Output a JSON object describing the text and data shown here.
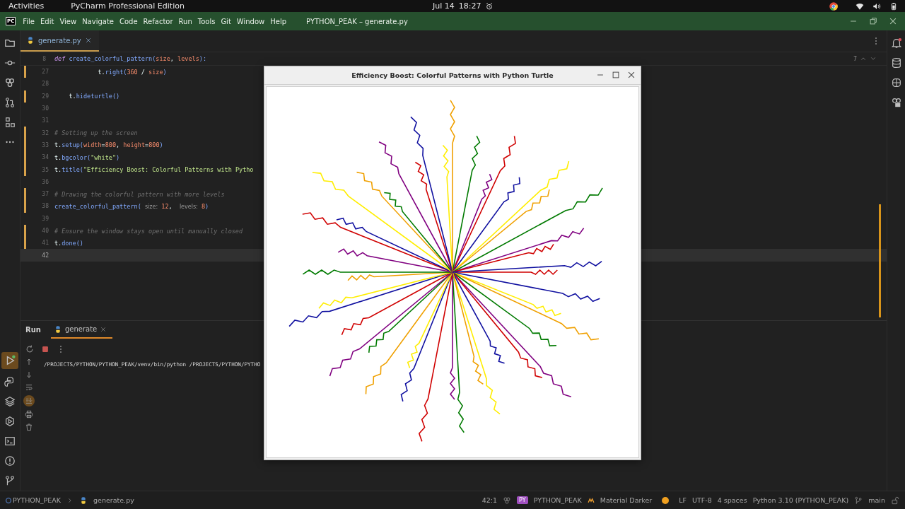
{
  "system_bar": {
    "activities": "Activities",
    "app_name": "PyCharm Professional Edition",
    "date": "Jul 14",
    "time": "18:27"
  },
  "title_bar": {
    "logo": "PC",
    "menu": [
      "File",
      "Edit",
      "View",
      "Navigate",
      "Code",
      "Refactor",
      "Run",
      "Tools",
      "Git",
      "Window",
      "Help"
    ],
    "project_title": "PYTHON_PEAK – generate.py"
  },
  "editor_tabs": [
    {
      "label": "generate.py",
      "selected": true
    }
  ],
  "inspection": {
    "count": "7"
  },
  "sticky_line": {
    "number": "8",
    "segments": [
      {
        "kind": "kw",
        "text": "def "
      },
      {
        "kind": "fn",
        "text": "create_colorful_pattern("
      },
      {
        "kind": "param",
        "text": "size"
      },
      {
        "kind": "plain",
        "text": ", "
      },
      {
        "kind": "param",
        "text": "levels"
      },
      {
        "kind": "fn",
        "text": "):"
      }
    ]
  },
  "code_lines": [
    {
      "number": "27",
      "changed": true,
      "current": false,
      "segments": [
        {
          "kind": "plain",
          "text": "            t."
        },
        {
          "kind": "fn",
          "text": "right("
        },
        {
          "kind": "num",
          "text": "360"
        },
        {
          "kind": "plain",
          "text": " / "
        },
        {
          "kind": "param",
          "text": "size"
        },
        {
          "kind": "fn",
          "text": ")"
        }
      ]
    },
    {
      "number": "28",
      "changed": false,
      "current": false
    },
    {
      "number": "29",
      "changed": true,
      "current": false,
      "segments": [
        {
          "kind": "plain",
          "text": "    t."
        },
        {
          "kind": "fn",
          "text": "hideturtle()"
        }
      ]
    },
    {
      "number": "30",
      "changed": false,
      "current": false
    },
    {
      "number": "31",
      "changed": false,
      "current": false
    },
    {
      "number": "32",
      "changed": true,
      "current": false,
      "segments": [
        {
          "kind": "comment",
          "text": "# Setting up the screen"
        }
      ]
    },
    {
      "number": "33",
      "changed": true,
      "current": false,
      "segments": [
        {
          "kind": "plain",
          "text": "t."
        },
        {
          "kind": "fn",
          "text": "setup("
        },
        {
          "kind": "param",
          "text": "width"
        },
        {
          "kind": "plain",
          "text": "="
        },
        {
          "kind": "num",
          "text": "800"
        },
        {
          "kind": "plain",
          "text": ", "
        },
        {
          "kind": "param",
          "text": "height"
        },
        {
          "kind": "plain",
          "text": "="
        },
        {
          "kind": "num",
          "text": "800"
        },
        {
          "kind": "fn",
          "text": ")"
        }
      ]
    },
    {
      "number": "34",
      "changed": true,
      "current": false,
      "segments": [
        {
          "kind": "plain",
          "text": "t."
        },
        {
          "kind": "fn",
          "text": "bgcolor("
        },
        {
          "kind": "str",
          "text": "\"white\""
        },
        {
          "kind": "fn",
          "text": ")"
        }
      ]
    },
    {
      "number": "35",
      "changed": true,
      "current": false,
      "segments": [
        {
          "kind": "plain",
          "text": "t."
        },
        {
          "kind": "fn",
          "text": "title("
        },
        {
          "kind": "str",
          "text": "\"Efficiency Boost: Colorful Patterns with Pytho"
        }
      ]
    },
    {
      "number": "36",
      "changed": false,
      "current": false
    },
    {
      "number": "37",
      "changed": true,
      "current": false,
      "segments": [
        {
          "kind": "comment",
          "text": "# Drawing the colorful pattern with more levels"
        }
      ]
    },
    {
      "number": "38",
      "changed": true,
      "current": false,
      "segments": [
        {
          "kind": "fn",
          "text": "create_colorful_pattern( "
        },
        {
          "kind": "hint",
          "text": "size:"
        },
        {
          "kind": "num",
          "text": " 12"
        },
        {
          "kind": "plain",
          "text": ",  "
        },
        {
          "kind": "hint",
          "text": "levels:"
        },
        {
          "kind": "num",
          "text": " 8"
        },
        {
          "kind": "fn",
          "text": ")"
        }
      ]
    },
    {
      "number": "39",
      "changed": false,
      "current": false
    },
    {
      "number": "40",
      "changed": true,
      "current": false,
      "segments": [
        {
          "kind": "comment",
          "text": "# Ensure the window stays open until manually closed"
        }
      ]
    },
    {
      "number": "41",
      "changed": true,
      "current": false,
      "segments": [
        {
          "kind": "plain",
          "text": "t."
        },
        {
          "kind": "fn",
          "text": "done()"
        }
      ]
    },
    {
      "number": "42",
      "changed": false,
      "current": true
    }
  ],
  "run_panel": {
    "title": "Run",
    "tabs": [
      {
        "label": "generate",
        "selected": true
      }
    ],
    "console": [
      "/PROJECTS/PYTHON/PYTHON_PEAK/venv/bin/python /PROJECTS/PYTHON/PYTHO"
    ]
  },
  "turtle_window": {
    "title": "Efficiency Boost: Colorful Patterns with Python Turtle"
  },
  "status_bar": {
    "breadcrumb": [
      "PYTHON_PEAK",
      "generate.py"
    ],
    "position": "42:1",
    "project_badge": "PY",
    "project": "PYTHON_PEAK",
    "theme": "Material Darker",
    "line_ending": "LF",
    "encoding": "UTF-8",
    "indent": "4 spaces",
    "interpreter": "Python 3.10 (PYTHON_PEAK)",
    "branch": "main"
  }
}
